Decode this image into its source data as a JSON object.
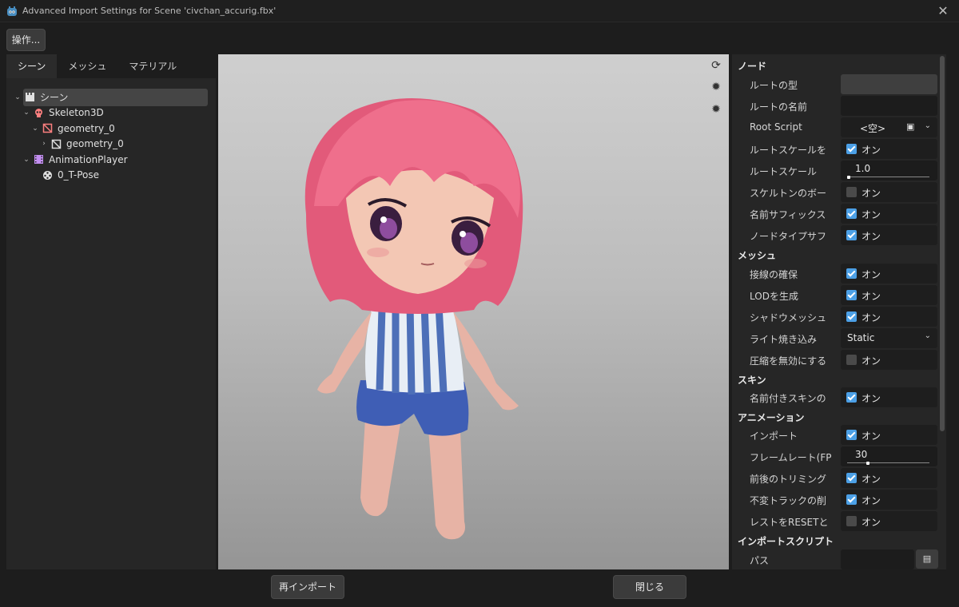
{
  "window": {
    "title": "Advanced Import Settings for Scene 'civchan_accurig.fbx'",
    "close_icon": "close-icon"
  },
  "toolbar": {
    "actions_label": "操作..."
  },
  "left_tabs": [
    "シーン",
    "メッシュ",
    "マテリアル"
  ],
  "tree": [
    {
      "label": "シーン",
      "icon": "clapperboard-icon",
      "depth": 0,
      "arrow": "expanded",
      "selected": true
    },
    {
      "label": "Skeleton3D",
      "icon": "skull-icon",
      "depth": 1,
      "arrow": "expanded"
    },
    {
      "label": "geometry_0",
      "icon": "mesh-icon",
      "depth": 2,
      "arrow": "expanded"
    },
    {
      "label": "geometry_0",
      "icon": "mesh-icon",
      "depth": 3,
      "arrow": "collapsed"
    },
    {
      "label": "AnimationPlayer",
      "icon": "film-icon",
      "depth": 1,
      "arrow": "expanded"
    },
    {
      "label": "0_T-Pose",
      "icon": "animation-icon",
      "depth": 2,
      "arrow": "none"
    }
  ],
  "viewport": {
    "buttons": [
      "orbit-icon",
      "light-1-icon",
      "light-2-icon"
    ]
  },
  "properties": {
    "section_node": "ノード",
    "root_type_label": "ルートの型",
    "root_name_label": "ルートの名前",
    "root_script_label": "Root Script",
    "root_script_value": "<空>",
    "apply_root_scale_label": "ルートスケールを",
    "root_scale_label": "ルートスケール",
    "root_scale_value": "1.0",
    "skeleton_bone_label": "スケルトンのボー",
    "name_suffix_label": "名前サフィックス",
    "node_type_suffix_label": "ノードタイプサフ",
    "section_mesh": "メッシュ",
    "ensure_tangents_label": "接線の確保",
    "generate_lod_label": "LODを生成",
    "shadow_mesh_label": "シャドウメッシュ",
    "light_baking_label": "ライト焼き込み",
    "light_baking_value": "Static",
    "force_disable_compression_label": "圧縮を無効にする",
    "section_skins": "スキン",
    "named_skins_label": "名前付きスキンの",
    "section_animation": "アニメーション",
    "anim_import_label": "インポート",
    "framerate_label": "フレームレート(FP",
    "framerate_value": "30",
    "trimming_label": "前後のトリミング",
    "remove_immutable_label": "不変トラックの削",
    "rest_reset_label": "レストをRESETと",
    "section_import_script": "インポートスクリプト",
    "path_label": "パス",
    "on_text": "オン"
  },
  "checkbox_states": {
    "apply_root_scale": true,
    "skeleton_bone": false,
    "name_suffix": true,
    "node_type_suffix": true,
    "ensure_tangents": true,
    "generate_lod": true,
    "shadow_mesh": true,
    "force_disable_compression": false,
    "named_skins": true,
    "anim_import": true,
    "trimming": true,
    "remove_immutable": true,
    "rest_reset": false
  },
  "footer": {
    "reimport_label": "再インポート",
    "close_label": "閉じる"
  },
  "colors": {
    "accent": "#4ca0e6",
    "panel": "#262626",
    "background": "#1d1d1d"
  }
}
